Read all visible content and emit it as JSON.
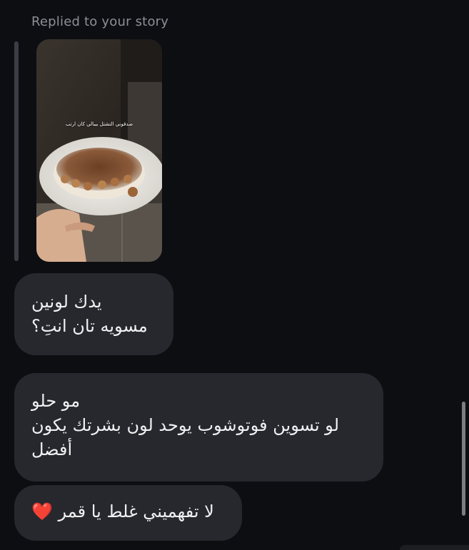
{
  "story_reply": {
    "label": "Replied to your story",
    "caption": "صدقوني التشتل بيبالي كان ارتب"
  },
  "messages": [
    {
      "lines": [
        "يدك لونين",
        "مسويه تان انتِ؟"
      ]
    },
    {
      "lines": [
        "مو حلو",
        "لو تسوين فوتوشوب يوحد لون بشرتك يكون",
        "أفضل"
      ]
    },
    {
      "text": "لا تفهميني غلط يا قمر",
      "emoji": "❤️"
    }
  ],
  "colors": {
    "background": "#0c0e12",
    "bubble": "#26282d",
    "text": "#f1f1f3",
    "muted": "#8c8f96"
  }
}
